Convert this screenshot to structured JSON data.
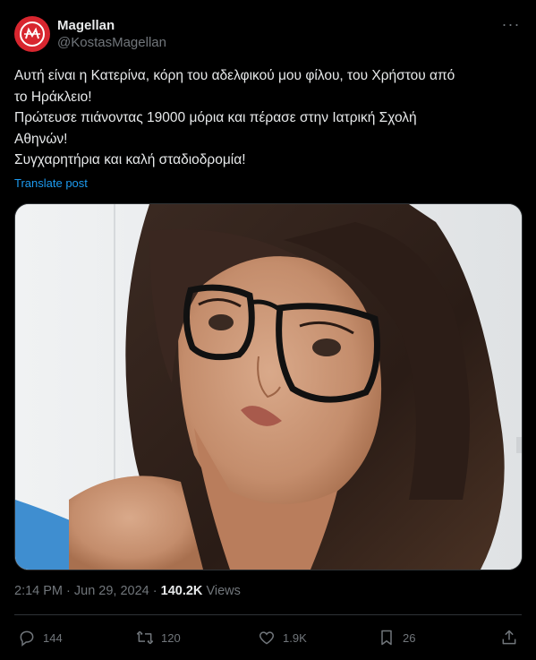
{
  "author": {
    "display_name": "Magellan",
    "handle": "@KostasMagellan",
    "avatar_color": "#d8262f"
  },
  "tweet": {
    "lines": [
      "Αυτή είναι η Κατερίνα, κόρη του αδελφικού μου φίλου, του Χρήστου από",
      "το Ηράκλειο!",
      "Πρώτευσε πιάνοντας 19000 μόρια και πέρασε στην Ιατρική Σχολή",
      "Αθηνών!",
      "Συγχαρητήρια και καλή σταδιοδρομία!"
    ],
    "translate_label": "Translate post"
  },
  "meta": {
    "time": "2:14 PM",
    "date": "Jun 29, 2024",
    "views_count": "140.2K",
    "views_label": "Views"
  },
  "actions": {
    "reply_count": "144",
    "repost_count": "120",
    "like_count": "1.9K",
    "bookmark_count": "26"
  },
  "colors": {
    "accent": "#1d9bf0",
    "muted": "#71767b",
    "text": "#e7e9ea",
    "bg": "#000000"
  }
}
